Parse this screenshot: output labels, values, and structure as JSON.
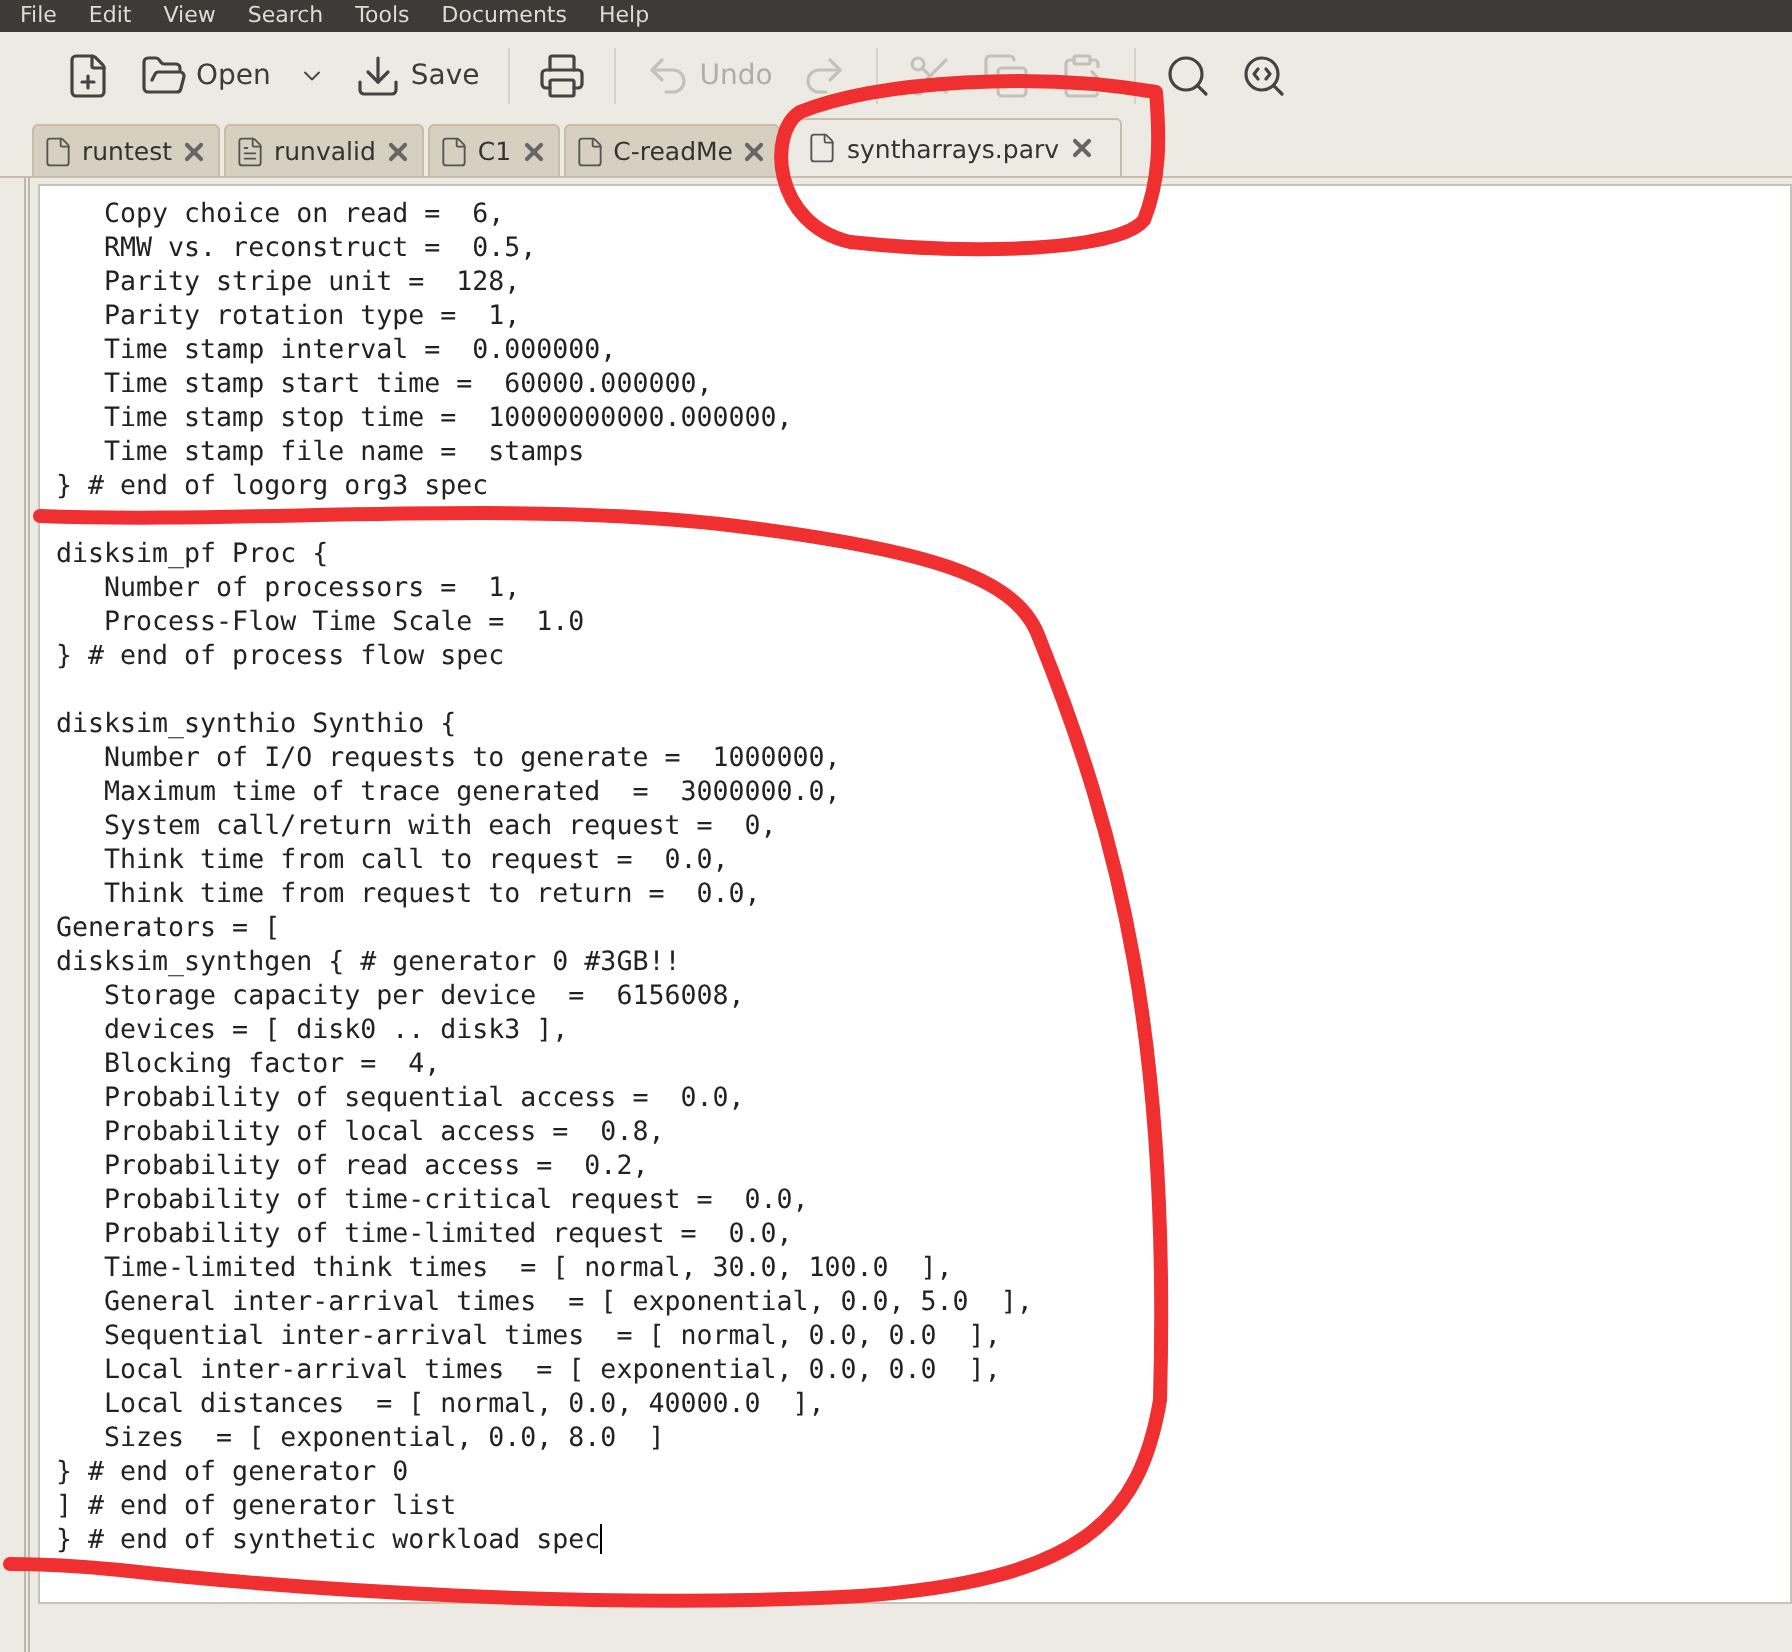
{
  "menu": [
    "File",
    "Edit",
    "View",
    "Search",
    "Tools",
    "Documents",
    "Help"
  ],
  "toolbar": [
    {
      "kind": "new",
      "disabled": false
    },
    {
      "kind": "open",
      "label": "Open",
      "disabled": false
    },
    {
      "kind": "dropdown",
      "disabled": false
    },
    {
      "kind": "save",
      "label": "Save",
      "disabled": false
    },
    {
      "kind": "sep"
    },
    {
      "kind": "print",
      "disabled": false
    },
    {
      "kind": "sep"
    },
    {
      "kind": "undo",
      "label": "Undo",
      "disabled": true
    },
    {
      "kind": "redo",
      "disabled": true
    },
    {
      "kind": "sep"
    },
    {
      "kind": "cut",
      "disabled": true
    },
    {
      "kind": "copy",
      "disabled": true
    },
    {
      "kind": "paste",
      "disabled": true
    },
    {
      "kind": "sep"
    },
    {
      "kind": "find",
      "disabled": false
    },
    {
      "kind": "replace",
      "disabled": false
    }
  ],
  "tabs": [
    {
      "label": "runtest",
      "kind": "file",
      "selected": false
    },
    {
      "label": "runvalid",
      "kind": "script",
      "selected": false
    },
    {
      "label": "C1",
      "kind": "file",
      "selected": false
    },
    {
      "label": "C-readMe",
      "kind": "file",
      "selected": false
    },
    {
      "label": "syntharrays.parv",
      "kind": "file",
      "selected": true
    }
  ],
  "blocks": [
    [
      "   Copy choice on read =  6,",
      "   RMW vs. reconstruct =  0.5,",
      "   Parity stripe unit =  128,",
      "   Parity rotation type =  1,",
      "   Time stamp interval =  0.000000,",
      "   Time stamp start time =  60000.000000,",
      "   Time stamp stop time =  10000000000.000000,",
      "   Time stamp file name =  stamps",
      "} # end of logorg org3 spec"
    ],
    [
      "disksim_pf Proc {",
      "   Number of processors =  1,",
      "   Process-Flow Time Scale =  1.0",
      "} # end of process flow spec"
    ],
    [
      "disksim_synthio Synthio {",
      "   Number of I/O requests to generate =  1000000,",
      "   Maximum time of trace generated  =  3000000.0,",
      "   System call/return with each request =  0,",
      "   Think time from call to request =  0.0,",
      "   Think time from request to return =  0.0,",
      "Generators = [",
      "disksim_synthgen { # generator 0 #3GB!!",
      "   Storage capacity per device  =  6156008,",
      "   devices = [ disk0 .. disk3 ],",
      "   Blocking factor =  4,",
      "   Probability of sequential access =  0.0,",
      "   Probability of local access =  0.8,",
      "   Probability of read access =  0.2,",
      "   Probability of time-critical request =  0.0,",
      "   Probability of time-limited request =  0.0,",
      "   Time-limited think times  = [ normal, 30.0, 100.0  ],",
      "   General inter-arrival times  = [ exponential, 0.0, 5.0  ],",
      "   Sequential inter-arrival times  = [ normal, 0.0, 0.0  ],",
      "   Local inter-arrival times  = [ exponential, 0.0, 0.0  ],",
      "   Local distances  = [ normal, 0.0, 40000.0  ],",
      "   Sizes  = [ exponential, 0.0, 8.0  ]",
      "} # end of generator 0",
      "] # end of generator list",
      "} # end of synthetic workload spec"
    ]
  ],
  "annotations": {
    "tab_loop": true,
    "text_loop": true
  }
}
